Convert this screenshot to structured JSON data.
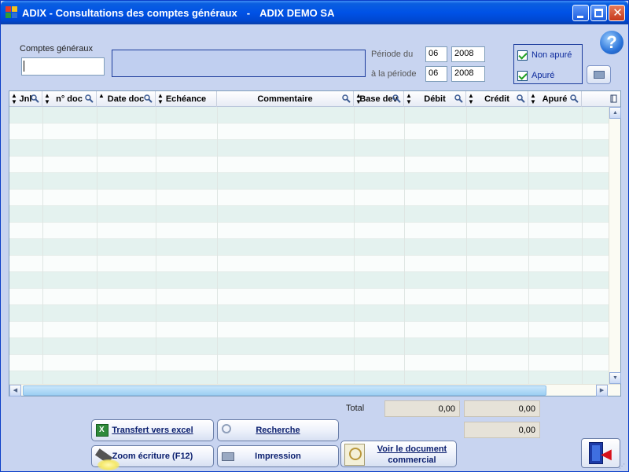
{
  "window": {
    "app": "ADIX",
    "title": "ADIX - Consultations des comptes généraux",
    "separator": "-",
    "company": "ADIX DEMO SA"
  },
  "form": {
    "comptes_label": "Comptes généraux",
    "compte_value": "",
    "periode_du_label": "Période du",
    "periode_au_label": "à la période",
    "periode_du_month": "06",
    "periode_du_year": "2008",
    "periode_au_month": "06",
    "periode_au_year": "2008",
    "non_apure_label": "Non apuré",
    "apure_label": "Apuré",
    "non_apure_checked": true,
    "apure_checked": true
  },
  "grid": {
    "columns": [
      "Jnl",
      "n° doc",
      "Date doc",
      "Echéance",
      "Commentaire",
      "Base dev",
      "Débit",
      "Crédit",
      "Apuré"
    ],
    "rows": []
  },
  "totals": {
    "label": "Total",
    "debit": "0,00",
    "credit": "0,00",
    "solde": "0,00"
  },
  "buttons": {
    "transfert_excel": "Transfert vers excel",
    "recherche": "Recherche",
    "zoom_ecriture": "Zoom écriture (F12)",
    "impression": "Impression",
    "voir_document_line1": "Voir le document",
    "voir_document_line2": "commercial"
  },
  "icons": {
    "help": "help-icon",
    "print": "printer-icon",
    "exit": "exit-door-icon",
    "excel": "excel-icon",
    "search": "magnifier-icon"
  },
  "colors": {
    "titlebar": "#0052e6",
    "background": "#c8d4f0",
    "row_alt": "#e4f2ef",
    "accent_text": "#0c2a9c"
  }
}
